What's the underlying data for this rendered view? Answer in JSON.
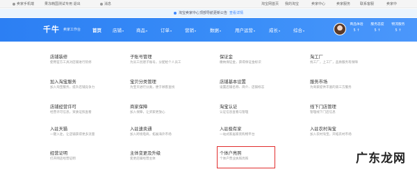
{
  "topbar": {
    "items": [
      {
        "label": "卖家手机端",
        "icon": "mobile-icon"
      },
      {
        "label": "果冻韩国测试专用 退出"
      },
      {
        "label": "消息",
        "icon": "message-icon"
      }
    ],
    "right_items": [
      "淘宝网首页",
      "我的淘宝",
      "卖家中心",
      "卖家服务",
      "联系客服",
      "卖家中"
    ]
  },
  "notice": {
    "text": "淘宝卖家中心顶部导航更新公告",
    "link": "查看详情"
  },
  "nav": {
    "logo": "千牛",
    "logo_sub": "卖家工作台",
    "menu": [
      {
        "label": "首页",
        "active": true
      },
      {
        "label": "店铺",
        "caret": "▾"
      },
      {
        "label": "商品",
        "caret": "▾"
      },
      {
        "label": "订单",
        "caret": "▾"
      },
      {
        "label": "营销",
        "caret": "▾"
      },
      {
        "label": "数据",
        "caret": "▾"
      },
      {
        "label": "用户运营",
        "caret": "▾"
      },
      {
        "label": "成长",
        "caret": "▾"
      },
      {
        "label": "综合",
        "caret": "▾"
      }
    ],
    "stats": [
      {
        "label": "商品体验",
        "value": "5 ↑"
      },
      {
        "label": "服务态度",
        "value": "5 ↑"
      },
      {
        "label": "物流服务",
        "value": "5 ↑"
      }
    ]
  },
  "services": [
    {
      "title": "店铺装修",
      "desc": "使用官方工具对店铺进行装修"
    },
    {
      "title": "子账号管理",
      "desc": "为员工创建子账号，分配给个人员工"
    },
    {
      "title": "保证金",
      "desc": "缴纳保证金，获得保证金标识"
    },
    {
      "title": "淘工厂",
      "desc": "找工厂，上工厂，品质服务有保障"
    },
    {
      "title": "加入淘宝服务",
      "desc": "加入淘宝服务，提升店铺竞争力"
    },
    {
      "title": "宝贝分类管理",
      "desc": "为宝贝进行分类，便于顾客查找"
    },
    {
      "title": "店铺基本设置",
      "desc": "设置店铺名称、简介、店铺标志"
    },
    {
      "title": "服务市场",
      "desc": "为商家提供丰富的第三方服务"
    },
    {
      "title": "店铺经营许可",
      "desc": "经营许可信息，资质证照查看"
    },
    {
      "title": "商家保障",
      "desc": "加入保障，让买家更放心"
    },
    {
      "title": "淘宝认证",
      "desc": "认证信息查看与管理"
    },
    {
      "title": "线下门店管理",
      "desc": "管理线下门店信息"
    },
    {
      "title": "入驻天猫",
      "desc": "一键入驻，让店铺获得更多流量"
    },
    {
      "title": "入驻速卖通",
      "desc": "加入跨境电商，拓展海外市场"
    },
    {
      "title": "入驻极有家",
      "desc": "一站式家居家装购物平台"
    },
    {
      "title": "入驻农村淘宝",
      "desc": "加入农村淘宝，开拓农村市场"
    },
    {
      "title": "经营证明",
      "desc": "打开网店经营证明"
    },
    {
      "title": "主体变更及升级",
      "desc": "变更店铺经营主体"
    },
    {
      "title": "个体户亮照",
      "desc": "个体户营业执照亮照"
    }
  ],
  "watermark": "广东龙网"
}
